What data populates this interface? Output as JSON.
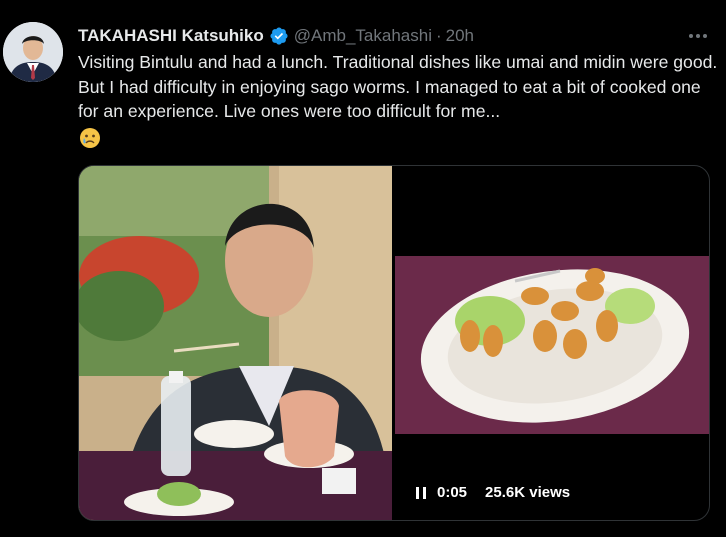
{
  "tweet": {
    "author_name": "TAKAHASHI Katsuhiko",
    "handle": "@Amb_Takahashi",
    "separator": "·",
    "time_ago": "20h",
    "text": "Visiting Bintulu and had a lunch. Traditional dishes like umai and midin were good. But I had difficulty in enjoying sago worms. I managed to eat a bit of cooked one for an experience. Live ones were too difficult for me...",
    "emoji_icon": "sad-tear-emoji-icon"
  },
  "video": {
    "elapsed": "0:05",
    "views": "25.6K views"
  },
  "icons": {
    "verified": "verified-badge-icon",
    "more": "more-options-icon",
    "pause": "pause-icon"
  },
  "colors": {
    "background": "#000000",
    "text": "#e7e9ea",
    "secondary": "#71767b",
    "verified": "#1d9bf0"
  }
}
